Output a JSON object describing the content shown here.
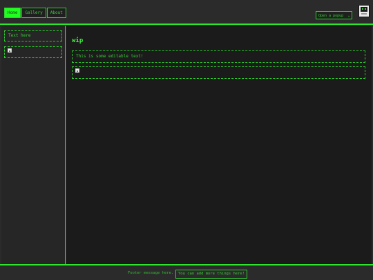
{
  "header": {
    "nav": [
      {
        "label": "Home",
        "active": true
      },
      {
        "label": "Gallery",
        "active": false
      },
      {
        "label": "About",
        "active": false
      }
    ],
    "popup_select": {
      "selected": "Open a popup"
    }
  },
  "sidebar": {
    "text": "Text here"
  },
  "main": {
    "title": "wip",
    "editable_text": "This is some editable text!"
  },
  "footer": {
    "message": "Footer message here.",
    "link": "You can add more things here!"
  },
  "colors": {
    "accent": "#2ee52e",
    "background": "#2b2b2b",
    "panel": "#1b1b1b"
  }
}
